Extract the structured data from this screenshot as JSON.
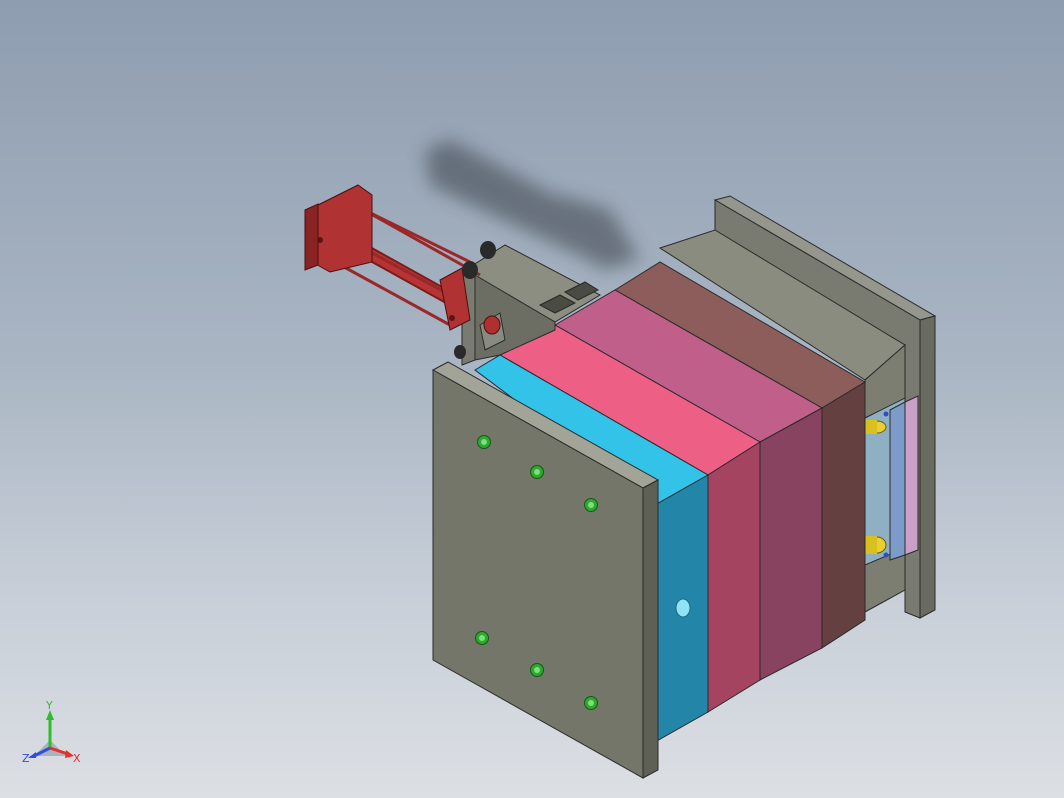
{
  "viewport": {
    "background_top": "#8e9db0",
    "background_bottom": "#dcdfe4"
  },
  "model": {
    "parts": [
      {
        "name": "front-clamp-plate",
        "color": "#75766a"
      },
      {
        "name": "cavity-plate-a",
        "color": "#33c3e8"
      },
      {
        "name": "cavity-plate-b",
        "color": "#ee5f86"
      },
      {
        "name": "core-plate",
        "color": "#c0608a"
      },
      {
        "name": "support-plate",
        "color": "#8d5d5b"
      },
      {
        "name": "rear-clamp-plate",
        "color": "#7a7b70"
      },
      {
        "name": "hydraulic-cylinder",
        "color": "#b03232"
      }
    ]
  },
  "triad": {
    "y_label": "Y",
    "z_label": "Z",
    "x_label": "X",
    "y_color": "#2ebd2e",
    "z_color": "#2f4de0",
    "x_color": "#e03030"
  }
}
